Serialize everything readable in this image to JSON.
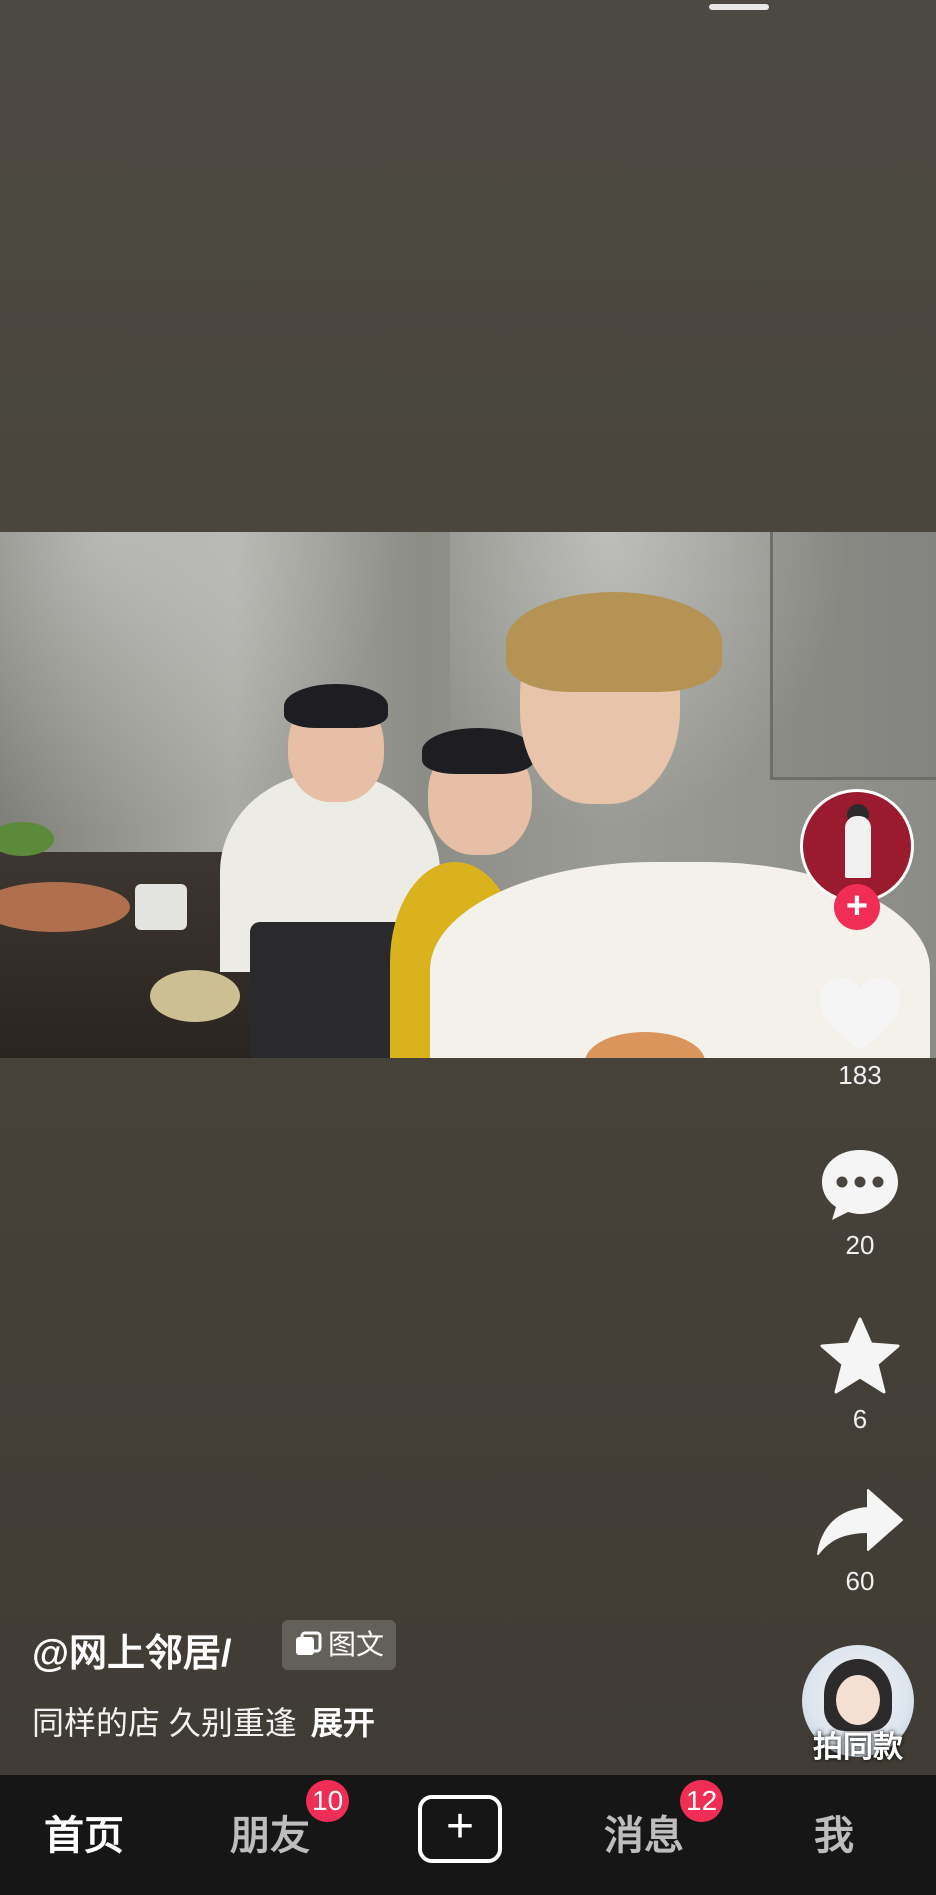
{
  "post": {
    "author": "@网上邻居/",
    "type_tag": "图文",
    "caption": "同样的店 久别重逢",
    "expand_label": "展开",
    "media_alt": "三个年轻人在餐厅里自拍合影"
  },
  "actions": {
    "follow_label": "+",
    "likes": "183",
    "comments": "20",
    "favorites": "6",
    "shares": "60"
  },
  "music": {
    "label": "拍同款"
  },
  "nav": {
    "home": "首页",
    "friends": "朋友",
    "friends_badge": "10",
    "create": "+",
    "messages": "消息",
    "messages_badge": "12",
    "me": "我"
  },
  "colors": {
    "accent": "#f02d54",
    "nav_bg": "#161616",
    "page_bg": "#4a463f"
  },
  "icons": [
    "heart-icon",
    "comment-icon",
    "star-icon",
    "share-icon",
    "images-icon",
    "plus-icon"
  ]
}
